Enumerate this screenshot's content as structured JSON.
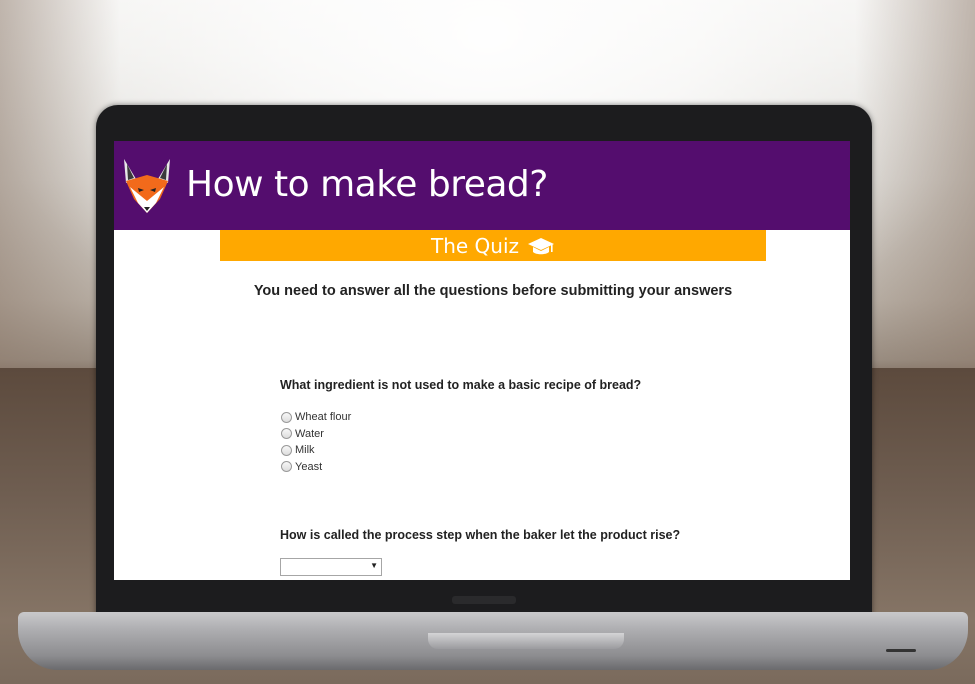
{
  "app": {
    "title": "How to make bread?"
  },
  "quiz_bar": {
    "label": "The Quiz",
    "icon": "graduation-cap-icon"
  },
  "instruction": "You need to answer all the questions before submitting your answers",
  "questions": [
    {
      "text": "What ingredient is not used to make a basic recipe of bread?",
      "type": "radio",
      "options": [
        "Wheat flour",
        "Water",
        "Milk",
        "Yeast"
      ]
    },
    {
      "text": "How is called the process step when the baker let the product rise?",
      "type": "select",
      "selected": ""
    }
  ],
  "colors": {
    "header": "#540d6e",
    "quiz_bar": "#ffa800",
    "fox": "#f26a1b"
  }
}
